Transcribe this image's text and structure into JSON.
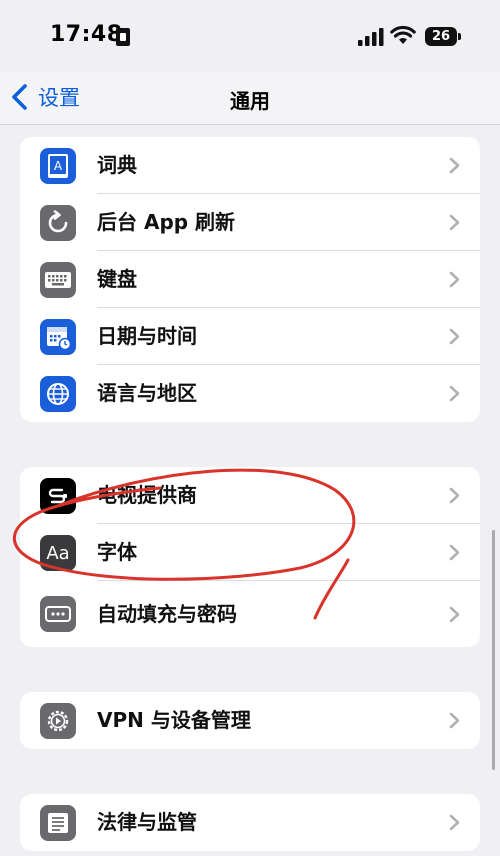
{
  "status_bar": {
    "time": "17:48",
    "battery": "26"
  },
  "nav": {
    "back_label": "设置",
    "title": "通用"
  },
  "groups": [
    {
      "items": [
        {
          "label": "词典",
          "icon": "dictionary-icon"
        },
        {
          "label": "后台 App 刷新",
          "icon": "background-refresh-icon"
        },
        {
          "label": "键盘",
          "icon": "keyboard-icon"
        },
        {
          "label": "日期与时间",
          "icon": "calendar-clock-icon"
        },
        {
          "label": "语言与地区",
          "icon": "globe-icon"
        }
      ]
    },
    {
      "items": [
        {
          "label": "电视提供商",
          "icon": "tv-provider-icon"
        },
        {
          "label": "字体",
          "icon": "font-icon",
          "icon_text": "Aa"
        },
        {
          "label": "自动填充与密码",
          "icon": "autofill-password-icon"
        }
      ]
    },
    {
      "items": [
        {
          "label": "VPN 与设备管理",
          "icon": "gear-icon"
        }
      ]
    },
    {
      "items": [
        {
          "label": "法律与监管",
          "icon": "document-icon"
        }
      ]
    }
  ],
  "colors": {
    "accent": "#0a5fdb",
    "annotation": "#d9342b",
    "background": "#efeff4"
  }
}
